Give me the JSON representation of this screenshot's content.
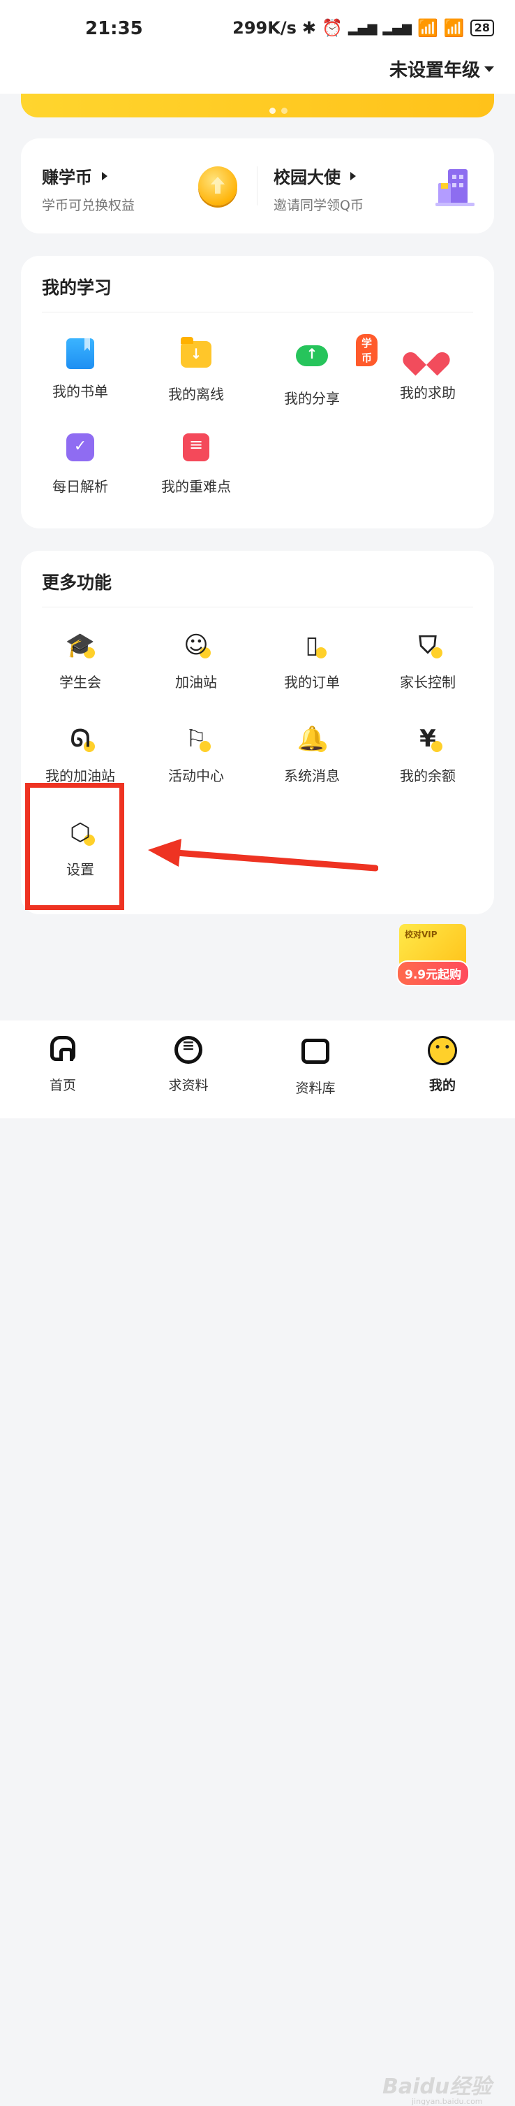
{
  "status_bar": {
    "time": "21:35",
    "network_speed": "299K/s",
    "bluetooth_icon": "bluetooth-icon",
    "alarm_icon": "alarm-icon",
    "battery": "28"
  },
  "header": {
    "grade_label": "未设置年级"
  },
  "promos": [
    {
      "title": "赚学币",
      "subtitle": "学币可兑换权益"
    },
    {
      "title": "校园大使",
      "subtitle": "邀请同学领Q币"
    }
  ],
  "study": {
    "title": "我的学习",
    "items": [
      {
        "label": "我的书单"
      },
      {
        "label": "我的离线"
      },
      {
        "label": "我的分享",
        "badge": "学币"
      },
      {
        "label": "我的求助"
      },
      {
        "label": "每日解析"
      },
      {
        "label": "我的重难点"
      }
    ]
  },
  "more": {
    "title": "更多功能",
    "items": [
      {
        "label": "学生会"
      },
      {
        "label": "加油站"
      },
      {
        "label": "我的订单"
      },
      {
        "label": "家长控制"
      },
      {
        "label": "我的加油站"
      },
      {
        "label": "活动中心"
      },
      {
        "label": "系统消息"
      },
      {
        "label": "我的余额"
      },
      {
        "label": "设置"
      }
    ]
  },
  "vip": {
    "tag": "校对VIP",
    "price": "9.9元起购"
  },
  "tabbar": {
    "tabs": [
      {
        "label": "首页"
      },
      {
        "label": "求资料"
      },
      {
        "label": "资料库"
      },
      {
        "label": "我的"
      }
    ]
  },
  "watermark": {
    "text": "Baidu经验",
    "sub": "jingyan.baidu.com"
  },
  "colors": {
    "accent": "#ffd02a",
    "annotation": "#ee3322"
  }
}
